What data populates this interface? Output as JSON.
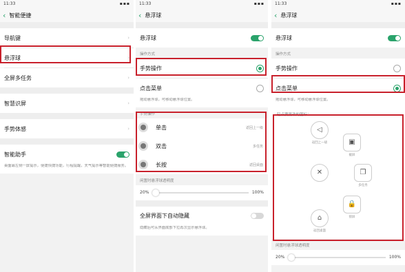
{
  "status": {
    "time": "11:33",
    "icons": "▪▪▪"
  },
  "panel1": {
    "title": "智能便捷",
    "items": [
      {
        "label": "导航键"
      },
      {
        "label": "悬浮球"
      },
      {
        "label": "全屏多任务"
      },
      {
        "label": "智慧识屏"
      },
      {
        "label": "手势体感"
      }
    ],
    "assistant": {
      "label": "智能助手",
      "desc": "桌面最左侧一屏提示，便捷快捷功能，行程提醒，天气提示等智能便捷服务。",
      "toggle": "on"
    }
  },
  "panel2": {
    "title": "悬浮球",
    "float_ball": {
      "label": "悬浮球",
      "toggle": "on"
    },
    "section_mode": "操作方式",
    "mode_gesture": "手势操作",
    "mode_menu": "点击菜单",
    "mode_desc": "拖动悬浮球，可移动悬浮球位置。",
    "gesture_section": "手势操作",
    "gestures": [
      {
        "label": "单击",
        "value": "返回上一级"
      },
      {
        "label": "双击",
        "value": "多任务"
      },
      {
        "label": "长按",
        "value": "返回桌面"
      }
    ],
    "opacity_label": "闲置时悬浮球透明度",
    "opacity_min": "20%",
    "opacity_max": "100%",
    "autohide_label": "全屏界面下自动隐藏",
    "autohide_desc": "隐藏后可从界面底部下拉再次显示悬浮球。",
    "autohide_toggle": "off"
  },
  "panel3": {
    "title": "悬浮球",
    "float_ball": {
      "label": "悬浮球",
      "toggle": "on"
    },
    "section_mode": "操作方式",
    "mode_gesture": "手势操作",
    "mode_menu": "点击菜单",
    "mode_desc": "拖动悬浮球，可移动悬浮球位置。",
    "menu_title": "轻点要更改的图标：",
    "menu_buttons": [
      {
        "icon": "◁",
        "label": "返回上一级"
      },
      {
        "icon": "▣",
        "label": "截屏"
      },
      {
        "icon": "✕",
        "label": ""
      },
      {
        "icon": "❐",
        "label": "多任务"
      },
      {
        "icon": "🔒",
        "label": "锁屏"
      },
      {
        "icon": "⌂",
        "label": "返回桌面"
      }
    ],
    "opacity_label": "闲置时悬浮球透明度",
    "opacity_min": "20%",
    "opacity_max": "100%"
  },
  "colors": {
    "accent": "#2aa36b",
    "highlight": "#c8202b"
  }
}
